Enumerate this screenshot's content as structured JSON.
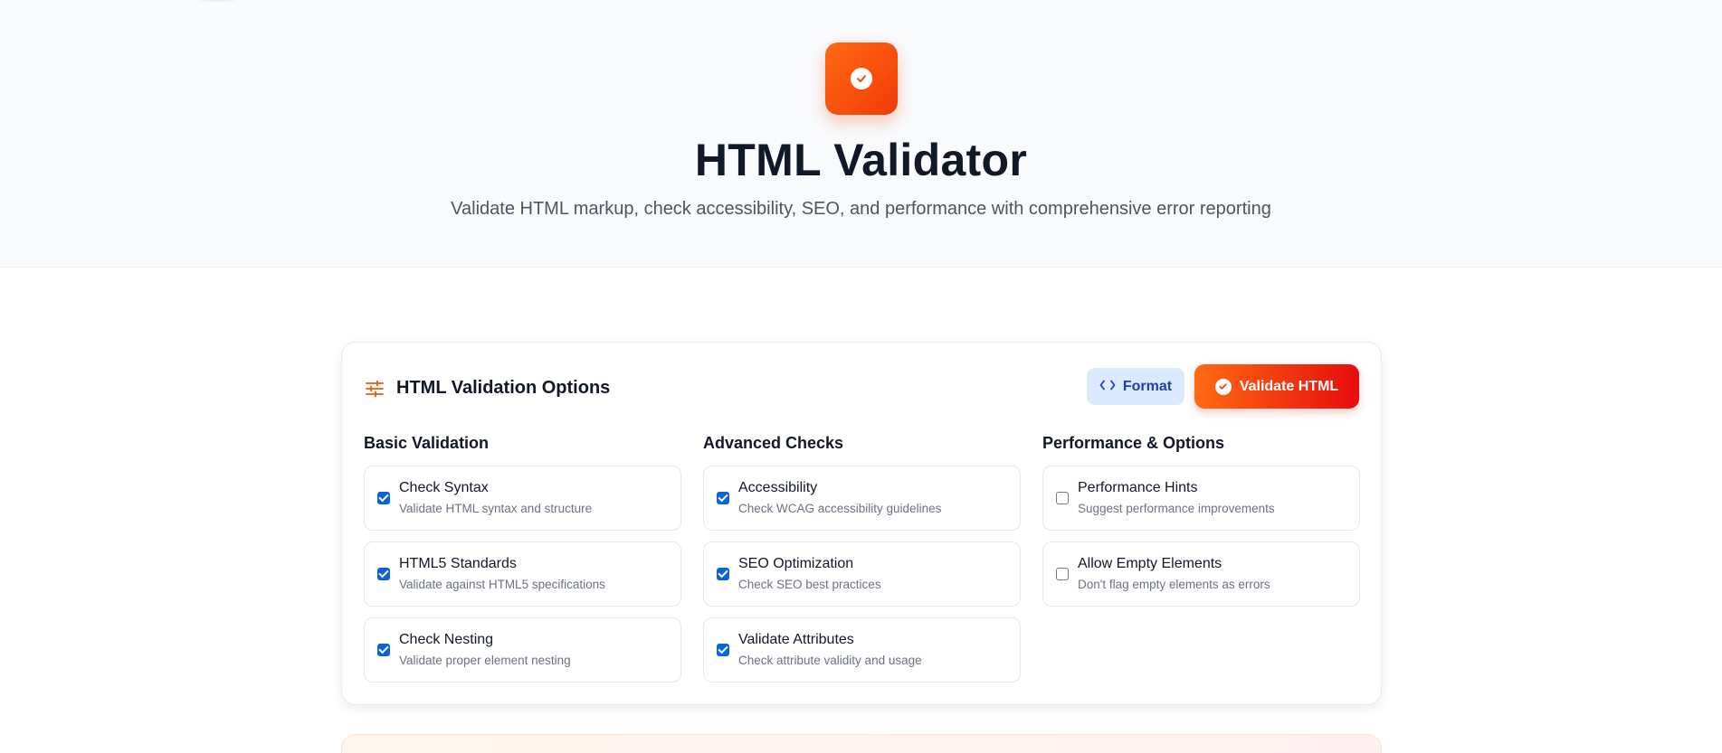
{
  "hero": {
    "title": "HTML Validator",
    "subtitle": "Validate HTML markup, check accessibility, SEO, and performance with comprehensive error reporting",
    "logo_icon": "check-circle-icon"
  },
  "panel": {
    "title": "HTML Validation Options",
    "title_icon": "sliders-icon",
    "format_button": {
      "label": "Format",
      "icon": "code-icon"
    },
    "validate_button": {
      "label": "Validate HTML",
      "icon": "check-circle-icon"
    },
    "columns": [
      {
        "heading": "Basic Validation",
        "options": [
          {
            "title": "Check Syntax",
            "description": "Validate HTML syntax and structure",
            "checked": true
          },
          {
            "title": "HTML5 Standards",
            "description": "Validate against HTML5 specifications",
            "checked": true
          },
          {
            "title": "Check Nesting",
            "description": "Validate proper element nesting",
            "checked": true
          }
        ]
      },
      {
        "heading": "Advanced Checks",
        "options": [
          {
            "title": "Accessibility",
            "description": "Check WCAG accessibility guidelines",
            "checked": true
          },
          {
            "title": "SEO Optimization",
            "description": "Check SEO best practices",
            "checked": true
          },
          {
            "title": "Validate Attributes",
            "description": "Check attribute validity and usage",
            "checked": true
          }
        ]
      },
      {
        "heading": "Performance & Options",
        "options": [
          {
            "title": "Performance Hints",
            "description": "Suggest performance improvements",
            "checked": false
          },
          {
            "title": "Allow Empty Elements",
            "description": "Don't flag empty elements as errors",
            "checked": false
          }
        ]
      }
    ]
  },
  "colors": {
    "accent_orange": "#ff6a13",
    "accent_red": "#e60d0d",
    "format_bg": "#dbeafe",
    "format_text": "#1e40af",
    "checkbox_blue": "#0b63d8"
  }
}
